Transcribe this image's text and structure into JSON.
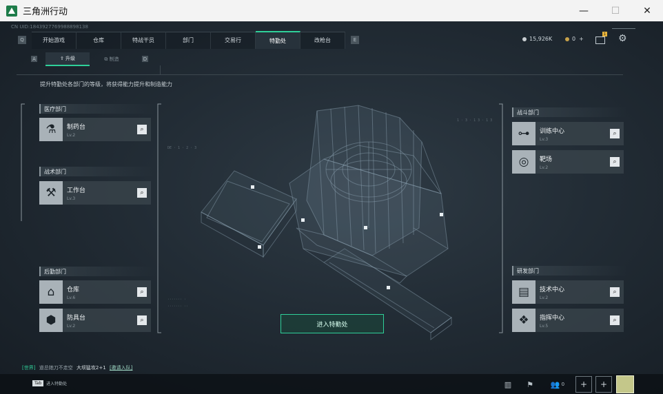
{
  "window": {
    "title": "三角洲行动",
    "minimize": "—",
    "maximize": "☐",
    "close": "✕"
  },
  "uid": "CN UID:1843927769988898138",
  "nav": {
    "left_key": "Q",
    "right_key": "E",
    "tabs": [
      "开始游戏",
      "仓库",
      "特战干员",
      "部门",
      "交易行",
      "特勤处",
      "改枪台"
    ],
    "active_tab": "特勤处"
  },
  "currency": {
    "coins": "15,926K",
    "tickets": "0",
    "plus": "+",
    "coin_color": "#c9ced2",
    "ticket_color": "#c8a24a"
  },
  "header_icons": {
    "mail_badge": "1",
    "mail": "mail-icon",
    "settings": "gear-icon"
  },
  "subnav": {
    "left_key": "A",
    "right_key": "D",
    "tabs": [
      "升级",
      "制造"
    ],
    "active": "升级"
  },
  "description": "提升特勤处各部门的等级，将获得能力提升和制造能力",
  "departments": {
    "medical": {
      "label": "医疗部门",
      "items": [
        {
          "name": "制药台",
          "level": "Lv.2",
          "icon": "microscope-icon"
        }
      ]
    },
    "tactical": {
      "label": "战术部门",
      "items": [
        {
          "name": "工作台",
          "level": "Lv.3",
          "icon": "tools-icon"
        }
      ]
    },
    "logistics": {
      "label": "后勤部门",
      "items": [
        {
          "name": "仓库",
          "level": "Lv.6",
          "icon": "warehouse-icon"
        },
        {
          "name": "防具台",
          "level": "Lv.2",
          "icon": "armor-icon"
        }
      ]
    },
    "combat": {
      "label": "战斗部门",
      "items": [
        {
          "name": "训练中心",
          "level": "Lv.3",
          "icon": "dumbbell-icon"
        },
        {
          "name": "靶场",
          "level": "Lv.2",
          "icon": "target-icon"
        }
      ]
    },
    "research": {
      "label": "研发部门",
      "items": [
        {
          "name": "技术中心",
          "level": "Lv.2",
          "icon": "monitor-icon"
        },
        {
          "name": "指挥中心",
          "level": "Lv.5",
          "icon": "command-icon"
        }
      ]
    }
  },
  "enter_button": "进入特勤处",
  "chat": {
    "channel": "[世界]",
    "user": "道总她刀不走空",
    "message": "大坝猛攻2+1",
    "link": "[邀请入队]",
    "channel_color": "#2fd19a"
  },
  "bottom": {
    "key": "Tab",
    "key_label": "进入特勤处",
    "friends_count": "0"
  },
  "accent": "#2fd19a"
}
